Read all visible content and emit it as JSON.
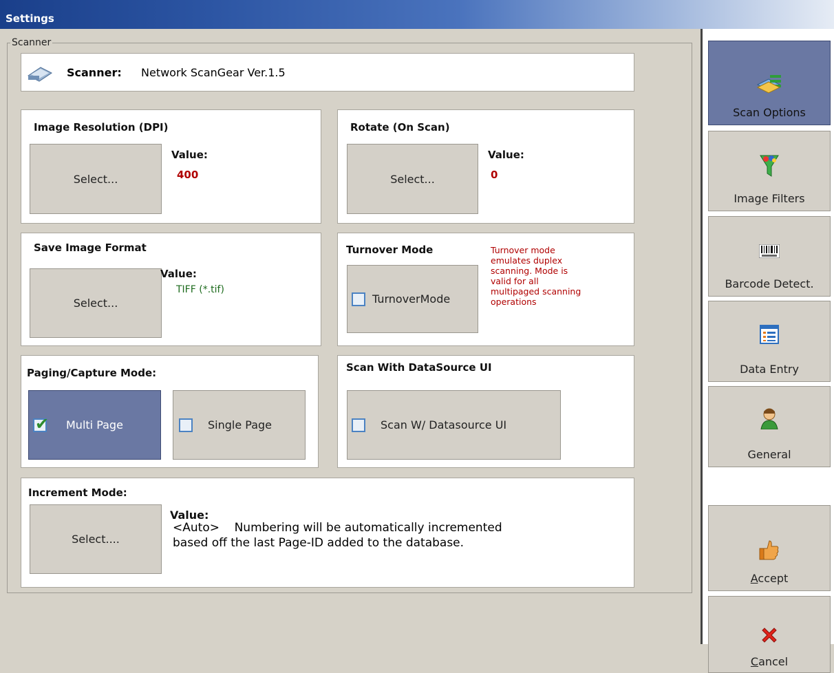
{
  "window": {
    "title": "Settings"
  },
  "scanner_group": {
    "legend": "Scanner",
    "scanner_label": "Scanner:",
    "scanner_name": "Network ScanGear Ver.1.5"
  },
  "image_resolution": {
    "title": "Image Resolution (DPI)",
    "button": "Select...",
    "value_label": "Value:",
    "value": "400"
  },
  "rotate": {
    "title": "Rotate (On Scan)",
    "button": "Select...",
    "value_label": "Value:",
    "value": "0"
  },
  "save_format": {
    "title": "Save Image Format",
    "button": "Select...",
    "value_label": "Value:",
    "value": "TIFF (*.tif)"
  },
  "turnover": {
    "title": "Turnover Mode",
    "checkbox_label": "TurnoverMode",
    "checked": false,
    "note": [
      "Turnover mode",
      "emulates duplex",
      "scanning.  Mode is",
      "valid for all",
      "multipaged scanning",
      "operations"
    ]
  },
  "paging": {
    "title": "Paging/Capture Mode:",
    "multi_label": "Multi Page",
    "multi_checked": true,
    "single_label": "Single Page",
    "single_checked": false
  },
  "datasource_ui": {
    "title": "Scan With DataSource UI",
    "checkbox_label": "Scan W/ Datasource UI",
    "checked": false
  },
  "increment": {
    "title": "Increment Mode:",
    "button": "Select....",
    "value_label": "Value:",
    "value_line1": "<Auto>    Numbering will be automatically incremented",
    "value_line2": "based off the last Page-ID added to the database."
  },
  "sidebar": {
    "items": [
      {
        "label": "Scan Options",
        "icon": "scan-options-icon",
        "active": true
      },
      {
        "label": "Image Filters",
        "icon": "image-filters-icon",
        "active": false
      },
      {
        "label": "Barcode Detect.",
        "icon": "barcode-icon",
        "active": false
      },
      {
        "label": "Data Entry",
        "icon": "data-entry-icon",
        "active": false
      },
      {
        "label": "General",
        "icon": "general-user-icon",
        "active": false
      }
    ],
    "accept": "Accept",
    "cancel": "Cancel"
  },
  "colors": {
    "active_button": "#6a78a3",
    "value_red": "#b00000",
    "value_green": "#1d6b1d",
    "checkbox_border": "#4b82c2"
  }
}
